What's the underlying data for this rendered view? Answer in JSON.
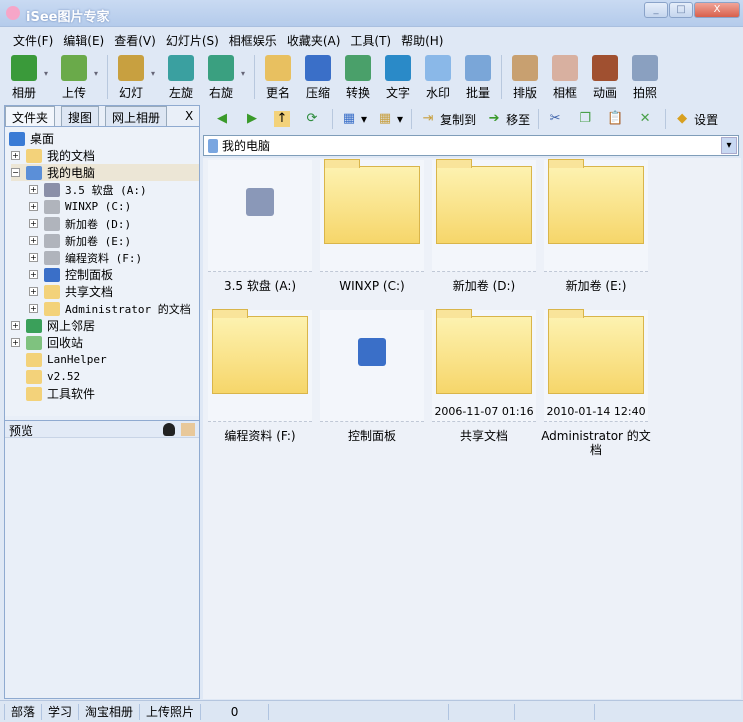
{
  "window": {
    "title": "iSee图片专家"
  },
  "menu": [
    "文件(F)",
    "编辑(E)",
    "查看(V)",
    "幻灯片(S)",
    "相框娱乐",
    "收藏夹(A)",
    "工具(T)",
    "帮助(H)"
  ],
  "toolbar": [
    {
      "label": "相册",
      "icon": "album-icon",
      "dd": true
    },
    {
      "label": "上传",
      "icon": "upload-icon",
      "dd": true,
      "sep": true
    },
    {
      "label": "幻灯",
      "icon": "slideshow-icon",
      "dd": true
    },
    {
      "label": "左旋",
      "icon": "rotate-left-icon"
    },
    {
      "label": "右旋",
      "icon": "rotate-right-icon",
      "dd": true,
      "sep": true
    },
    {
      "label": "更名",
      "icon": "rename-icon"
    },
    {
      "label": "压缩",
      "icon": "compress-icon"
    },
    {
      "label": "转换",
      "icon": "convert-icon"
    },
    {
      "label": "文字",
      "icon": "text-icon"
    },
    {
      "label": "水印",
      "icon": "watermark-icon"
    },
    {
      "label": "批量",
      "icon": "batch-icon",
      "sep": true
    },
    {
      "label": "排版",
      "icon": "layout-icon"
    },
    {
      "label": "相框",
      "icon": "frame-icon"
    },
    {
      "label": "动画",
      "icon": "animation-icon"
    },
    {
      "label": "拍照",
      "icon": "webcam-icon"
    }
  ],
  "left_tabs": [
    "文件夹",
    "搜图",
    "网上相册"
  ],
  "close_label": "X",
  "tree": [
    {
      "label": "桌面",
      "level": 0,
      "pm": "",
      "color": "#3a7bd5"
    },
    {
      "label": "我的文档",
      "level": 1,
      "pm": "+",
      "color": "#f3d27a"
    },
    {
      "label": "我的电脑",
      "level": 1,
      "pm": "−",
      "color": "#5b8fd8",
      "selected": true
    },
    {
      "label": "3.5 软盘 (A:)",
      "level": 2,
      "pm": "+",
      "color": "#8a8fa8",
      "mono": true
    },
    {
      "label": "WINXP (C:)",
      "level": 2,
      "pm": "+",
      "color": "#b0b4bc",
      "mono": true
    },
    {
      "label": "新加卷 (D:)",
      "level": 2,
      "pm": "+",
      "color": "#b0b4bc",
      "mono": true
    },
    {
      "label": "新加卷 (E:)",
      "level": 2,
      "pm": "+",
      "color": "#b0b4bc",
      "mono": true
    },
    {
      "label": "编程资料 (F:)",
      "level": 2,
      "pm": "+",
      "color": "#b0b4bc",
      "mono": true
    },
    {
      "label": "控制面板",
      "level": 2,
      "pm": "+",
      "color": "#3a6fc8"
    },
    {
      "label": "共享文档",
      "level": 2,
      "pm": "+",
      "color": "#f3d27a"
    },
    {
      "label": "Administrator 的文档",
      "level": 2,
      "pm": "+",
      "color": "#f3d27a",
      "mono": true
    },
    {
      "label": "网上邻居",
      "level": 1,
      "pm": "+",
      "color": "#3aa05a"
    },
    {
      "label": "回收站",
      "level": 1,
      "pm": "+",
      "color": "#7fc27f"
    },
    {
      "label": "LanHelper",
      "level": 1,
      "pm": "",
      "color": "#f3d27a",
      "mono": true
    },
    {
      "label": "v2.52",
      "level": 1,
      "pm": "",
      "color": "#f3d27a",
      "mono": true
    },
    {
      "label": "工具软件",
      "level": 1,
      "pm": "",
      "color": "#f3d27a"
    }
  ],
  "preview_label": "预览",
  "right_toolbar": {
    "copy_to": "复制到",
    "move_to": "移至",
    "settings": "设置"
  },
  "address": "我的电脑",
  "items": [
    {
      "label": "3.5 软盘 (A:)",
      "type": "floppy",
      "date": ""
    },
    {
      "label": "WINXP (C:)",
      "type": "folder",
      "date": ""
    },
    {
      "label": "新加卷 (D:)",
      "type": "folder",
      "date": ""
    },
    {
      "label": "新加卷 (E:)",
      "type": "folder",
      "date": ""
    },
    {
      "label": "编程资料 (F:)",
      "type": "folder",
      "date": ""
    },
    {
      "label": "控制面板",
      "type": "control",
      "date": ""
    },
    {
      "label": "共享文档",
      "type": "folder",
      "date": "2006-11-07 01:16"
    },
    {
      "label": "Administrator 的文档",
      "type": "folder",
      "date": "2010-01-14 12:40"
    }
  ],
  "status": [
    "部落",
    "学习",
    "淘宝相册",
    "上传照片",
    "0"
  ]
}
